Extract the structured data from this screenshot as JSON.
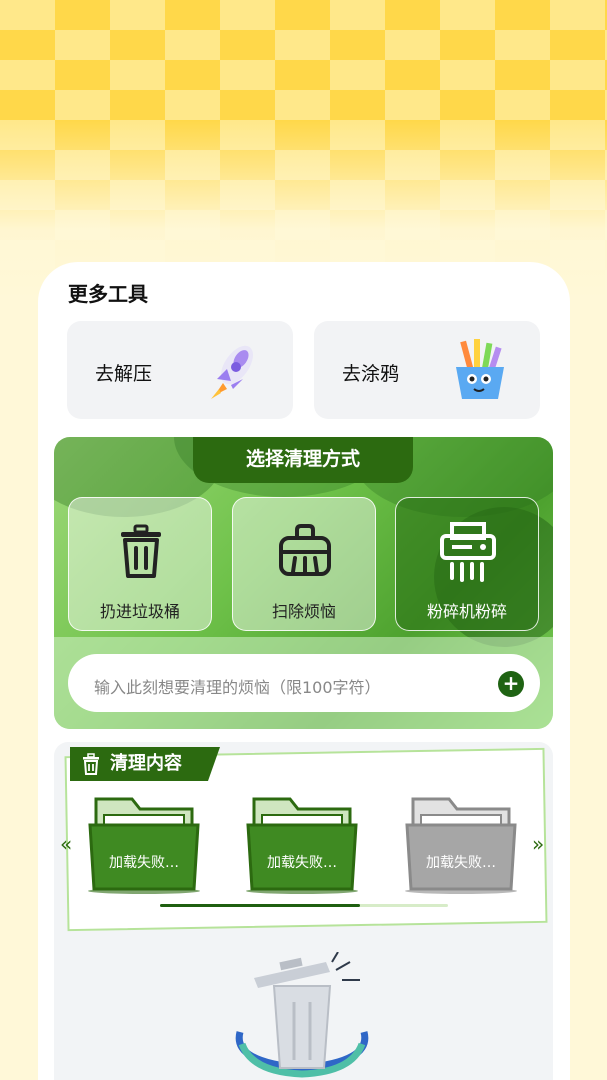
{
  "header": {
    "title": "更多工具"
  },
  "tools": [
    {
      "label": "去解压",
      "icon": "rocket-icon"
    },
    {
      "label": "去涂鸦",
      "icon": "pencil-cup-icon"
    }
  ],
  "clean_panel": {
    "title": "选择清理方式",
    "methods": [
      {
        "label": "扔进垃圾桶",
        "icon": "trash-can-icon"
      },
      {
        "label": "扫除烦恼",
        "icon": "dustpan-icon"
      },
      {
        "label": "粉碎机粉碎",
        "icon": "shredder-icon"
      }
    ],
    "input_placeholder": "输入此刻想要清理的烦恼（限100字符）"
  },
  "content_section": {
    "title": "清理内容",
    "folders": [
      {
        "label": "加载失败…",
        "state": "green"
      },
      {
        "label": "加载失败…",
        "state": "green"
      },
      {
        "label": "加载失败…",
        "state": "gray"
      }
    ]
  },
  "colors": {
    "accent": "#2c6a10",
    "panel_green": "#6fc24a",
    "background_yellow": "#ffd84a"
  }
}
